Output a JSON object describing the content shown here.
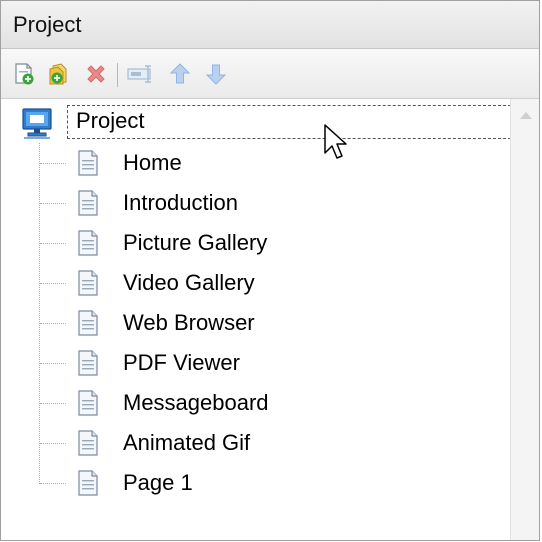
{
  "panel": {
    "title": "Project"
  },
  "toolbar": {
    "buttons": [
      {
        "icon": "add-page-icon"
      },
      {
        "icon": "add-folder-icon"
      },
      {
        "icon": "delete-icon"
      },
      {
        "icon": "rename-icon"
      },
      {
        "icon": "move-up-icon"
      },
      {
        "icon": "move-down-icon"
      }
    ]
  },
  "tree": {
    "root": {
      "label": "Project",
      "icon": "computer-icon"
    },
    "items": [
      {
        "label": "Home"
      },
      {
        "label": "Introduction"
      },
      {
        "label": "Picture Gallery"
      },
      {
        "label": "Video Gallery"
      },
      {
        "label": "Web Browser"
      },
      {
        "label": "PDF Viewer"
      },
      {
        "label": "Messageboard"
      },
      {
        "label": "Animated Gif"
      },
      {
        "label": "Page 1"
      }
    ]
  },
  "colors": {
    "accent_green": "#3aa33a",
    "delete_red": "#e05050",
    "arrow_blue": "#8fb4e6",
    "folder_yellow": "#e9c341"
  }
}
